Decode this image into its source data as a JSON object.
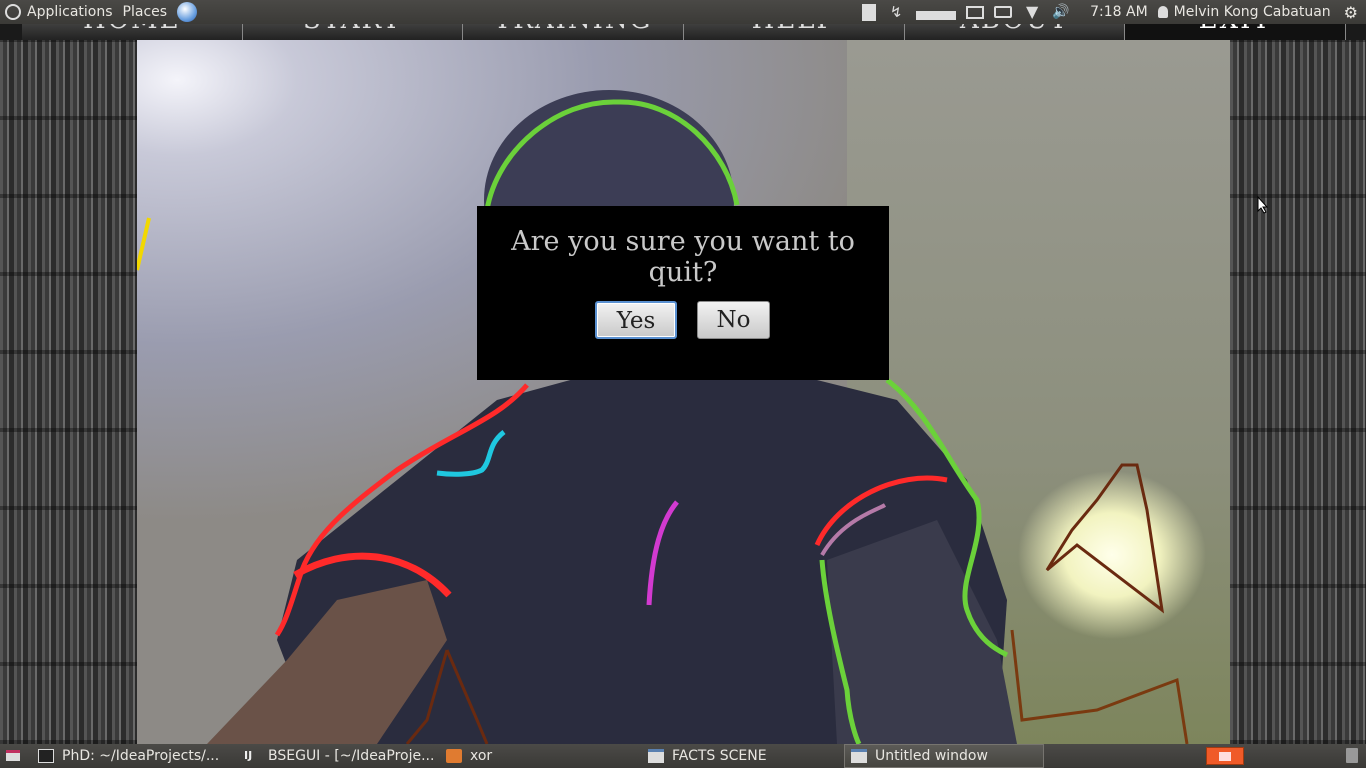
{
  "top_panel": {
    "applications_label": "Applications",
    "places_label": "Places",
    "clock": "7:18 AM",
    "user_name": "Melvin Kong Cabatuan"
  },
  "app_menu": {
    "items": [
      "HOME",
      "START",
      "TRAINING",
      "HELP",
      "ABOUT",
      "EXIT"
    ]
  },
  "dialog": {
    "message": "Are you sure you want to quit?",
    "yes_label": "Yes",
    "no_label": "No"
  },
  "taskbar": {
    "items": [
      {
        "label": "PhD: ~/IdeaProjects/..."
      },
      {
        "label": "BSEGUI - [~/IdeaProje..."
      },
      {
        "label": "xor"
      },
      {
        "label": "FACTS SCENE"
      },
      {
        "label": "Untitled window"
      }
    ]
  },
  "colors": {
    "panel": "#3c3b37",
    "dialog_bg": "#000000",
    "dialog_text": "#c9c9c9",
    "contour_green": "#6bd13a",
    "contour_red": "#ff2a2a",
    "contour_cyan": "#1fc8e0",
    "contour_brown": "#6a2a10",
    "workspace_switcher": "#f05a28"
  }
}
